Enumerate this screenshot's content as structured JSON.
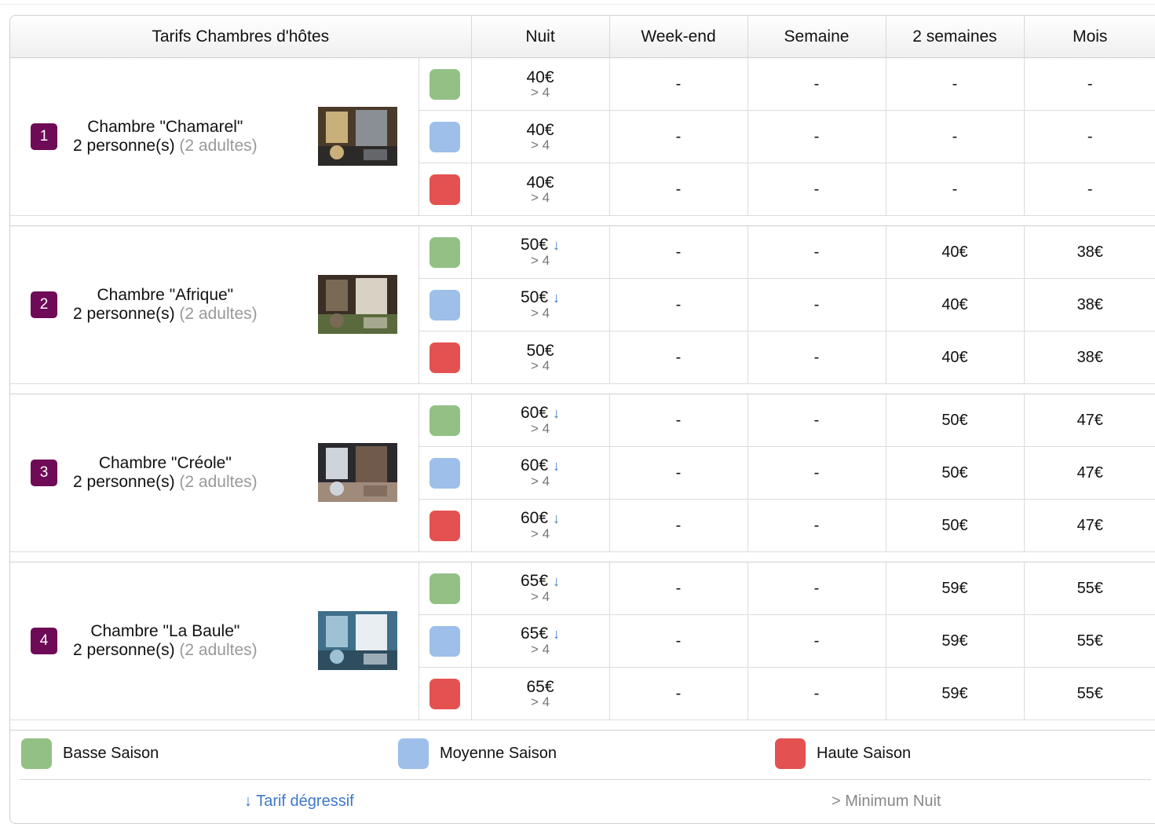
{
  "header": {
    "title": "Tarifs Chambres d'hôtes",
    "columns": [
      "Nuit",
      "Week-end",
      "Semaine",
      "2 semaines",
      "Mois"
    ]
  },
  "colors": {
    "basse": "#93c185",
    "moyenne": "#9dbfea",
    "haute": "#e35250",
    "badge": "#6e0a56",
    "link": "#3d78c9"
  },
  "rooms": [
    {
      "number": "1",
      "name": "Chambre \"Chamarel\"",
      "capacity": "2 personne(s)",
      "adults": "(2 adultes)",
      "rates": [
        {
          "nuit": "40€",
          "min": "> 4",
          "weekend": "-",
          "semaine": "-",
          "deux_semaines": "-",
          "mois": "-"
        },
        {
          "nuit": "40€",
          "min": "> 4",
          "weekend": "-",
          "semaine": "-",
          "deux_semaines": "-",
          "mois": "-"
        },
        {
          "nuit": "40€",
          "min": "> 4",
          "weekend": "-",
          "semaine": "-",
          "deux_semaines": "-",
          "mois": "-"
        }
      ]
    },
    {
      "number": "2",
      "name": "Chambre \"Afrique\"",
      "capacity": "2 personne(s)",
      "adults": "(2 adultes)",
      "rates": [
        {
          "nuit": "50€",
          "arrow": "↓",
          "min": "> 4",
          "weekend": "-",
          "semaine": "-",
          "deux_semaines": "40€",
          "mois": "38€"
        },
        {
          "nuit": "50€",
          "arrow": "↓",
          "min": "> 4",
          "weekend": "-",
          "semaine": "-",
          "deux_semaines": "40€",
          "mois": "38€"
        },
        {
          "nuit": "50€",
          "min": "> 4",
          "weekend": "-",
          "semaine": "-",
          "deux_semaines": "40€",
          "mois": "38€"
        }
      ]
    },
    {
      "number": "3",
      "name": "Chambre \"Créole\"",
      "capacity": "2 personne(s)",
      "adults": "(2 adultes)",
      "rates": [
        {
          "nuit": "60€",
          "arrow": "↓",
          "min": "> 4",
          "weekend": "-",
          "semaine": "-",
          "deux_semaines": "50€",
          "mois": "47€"
        },
        {
          "nuit": "60€",
          "arrow": "↓",
          "min": "> 4",
          "weekend": "-",
          "semaine": "-",
          "deux_semaines": "50€",
          "mois": "47€"
        },
        {
          "nuit": "60€",
          "arrow": "↓",
          "min": "> 4",
          "weekend": "-",
          "semaine": "-",
          "deux_semaines": "50€",
          "mois": "47€"
        }
      ]
    },
    {
      "number": "4",
      "name": "Chambre \"La Baule\"",
      "capacity": "2 personne(s)",
      "adults": "(2 adultes)",
      "rates": [
        {
          "nuit": "65€",
          "arrow": "↓",
          "min": "> 4",
          "weekend": "-",
          "semaine": "-",
          "deux_semaines": "59€",
          "mois": "55€"
        },
        {
          "nuit": "65€",
          "arrow": "↓",
          "min": "> 4",
          "weekend": "-",
          "semaine": "-",
          "deux_semaines": "59€",
          "mois": "55€"
        },
        {
          "nuit": "65€",
          "min": "> 4",
          "weekend": "-",
          "semaine": "-",
          "deux_semaines": "59€",
          "mois": "55€"
        }
      ]
    }
  ],
  "legend": {
    "basse": "Basse Saison",
    "moyenne": "Moyenne Saison",
    "haute": "Haute Saison",
    "degressif": "↓ Tarif dégressif",
    "minimum": "> Minimum Nuit"
  }
}
